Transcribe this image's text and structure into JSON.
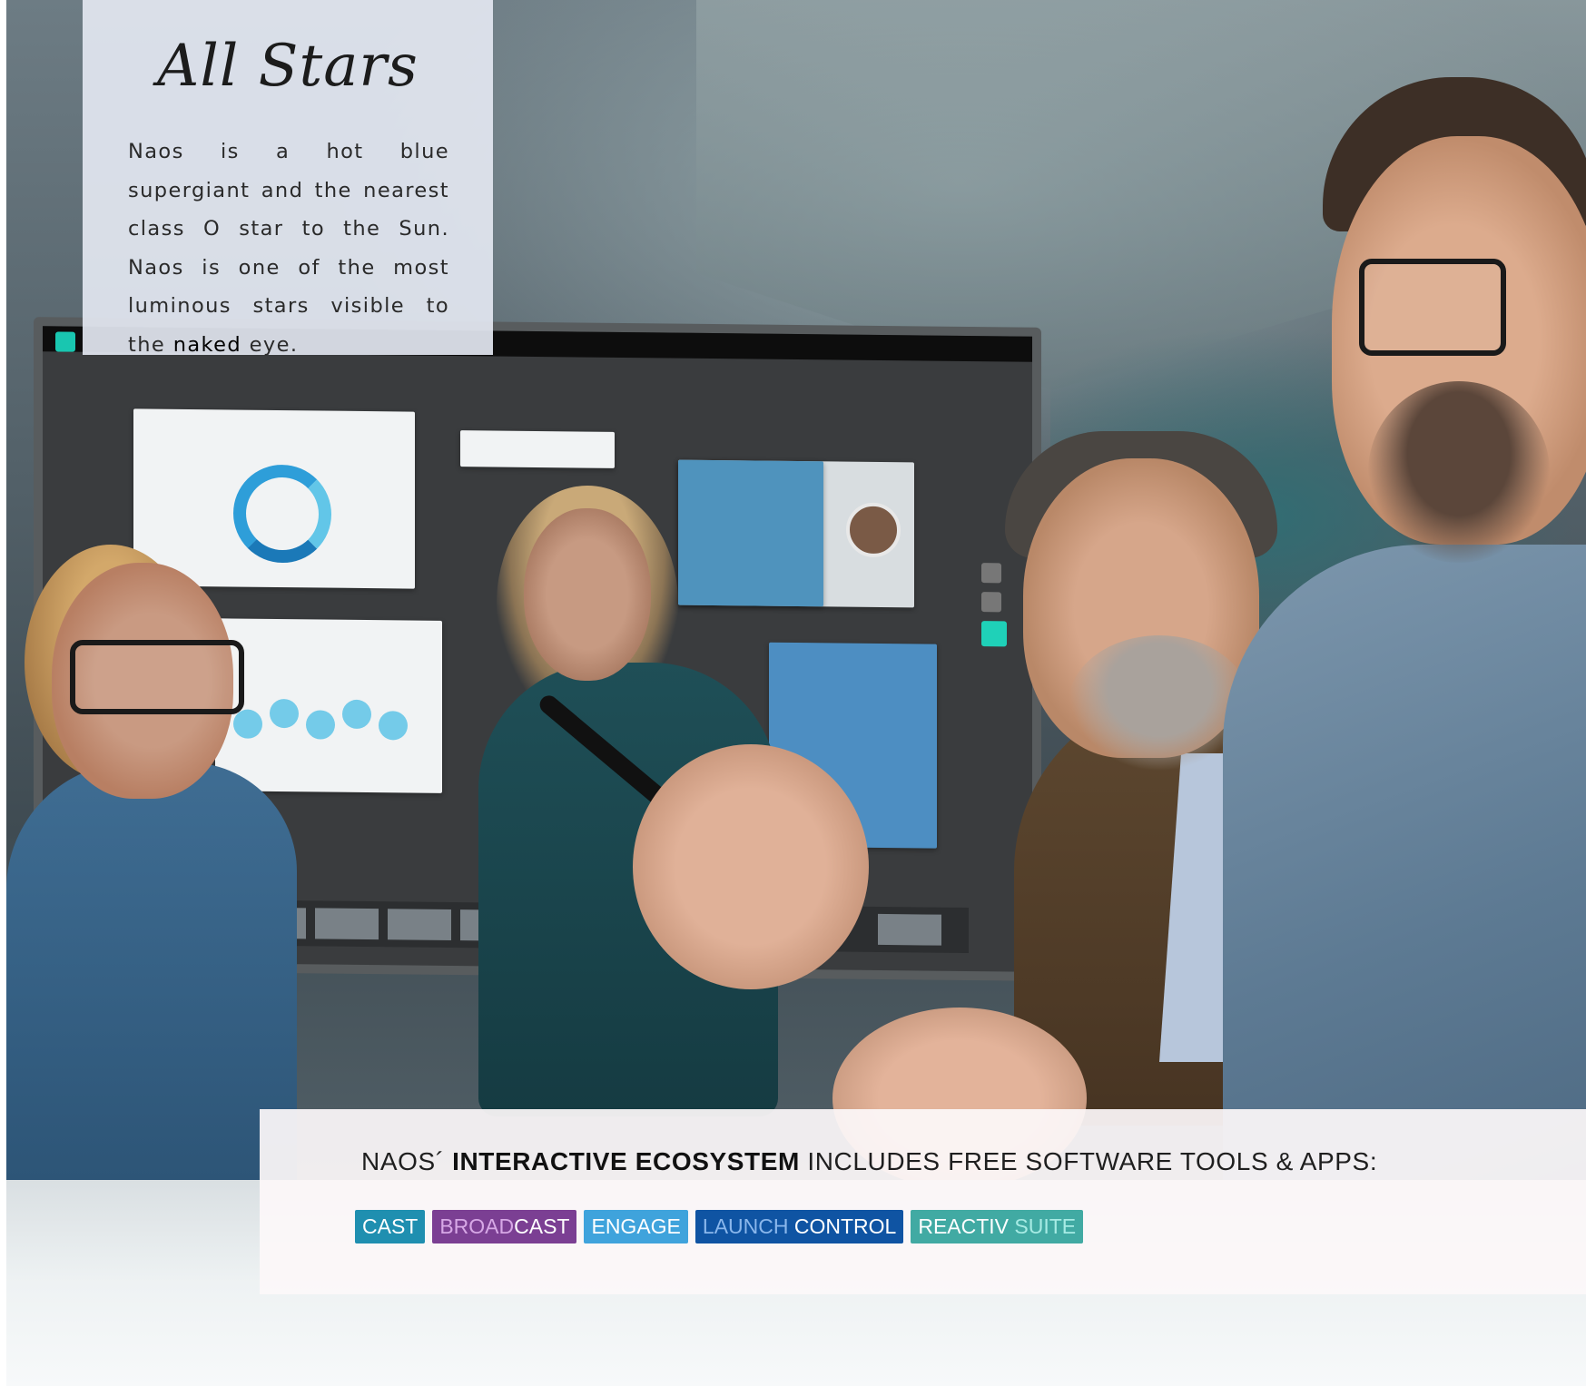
{
  "intro": {
    "title": "All Stars",
    "text_before": "Naos is a hot blue supergiant and the nearest class O star to the Sun. Naos is one of the most luminous stars visible to the ",
    "text_emph": "naked",
    "text_after": " eye."
  },
  "banner": {
    "heading_prefix": "NAOS´ ",
    "heading_bold": "INTERACTIVE ECOSYSTEM",
    "heading_suffix": " INCLUDES FREE SOFTWARE TOOLS & APPS:"
  },
  "apps": [
    {
      "part1": "CAST",
      "part2": "",
      "bg": "#1f8fb0",
      "c1": "#ffffff",
      "c2": "#ffffff"
    },
    {
      "part1": "BROAD",
      "part2": "CAST",
      "bg": "#7b3f93",
      "c1": "#d7a8e6",
      "c2": "#ffffff"
    },
    {
      "part1": "ENGAGE",
      "part2": "",
      "bg": "#3fa3dc",
      "c1": "#ffffff",
      "c2": "#ffffff"
    },
    {
      "part1": "LAUNCH ",
      "part2": "CONTROL",
      "bg": "#0f54a3",
      "c1": "#8ab7ec",
      "c2": "#ffffff"
    },
    {
      "part1": "REACTIV ",
      "part2": "SUITE",
      "bg": "#41aaa3",
      "c1": "#ffffff",
      "c2": "#a7ebe4"
    }
  ]
}
